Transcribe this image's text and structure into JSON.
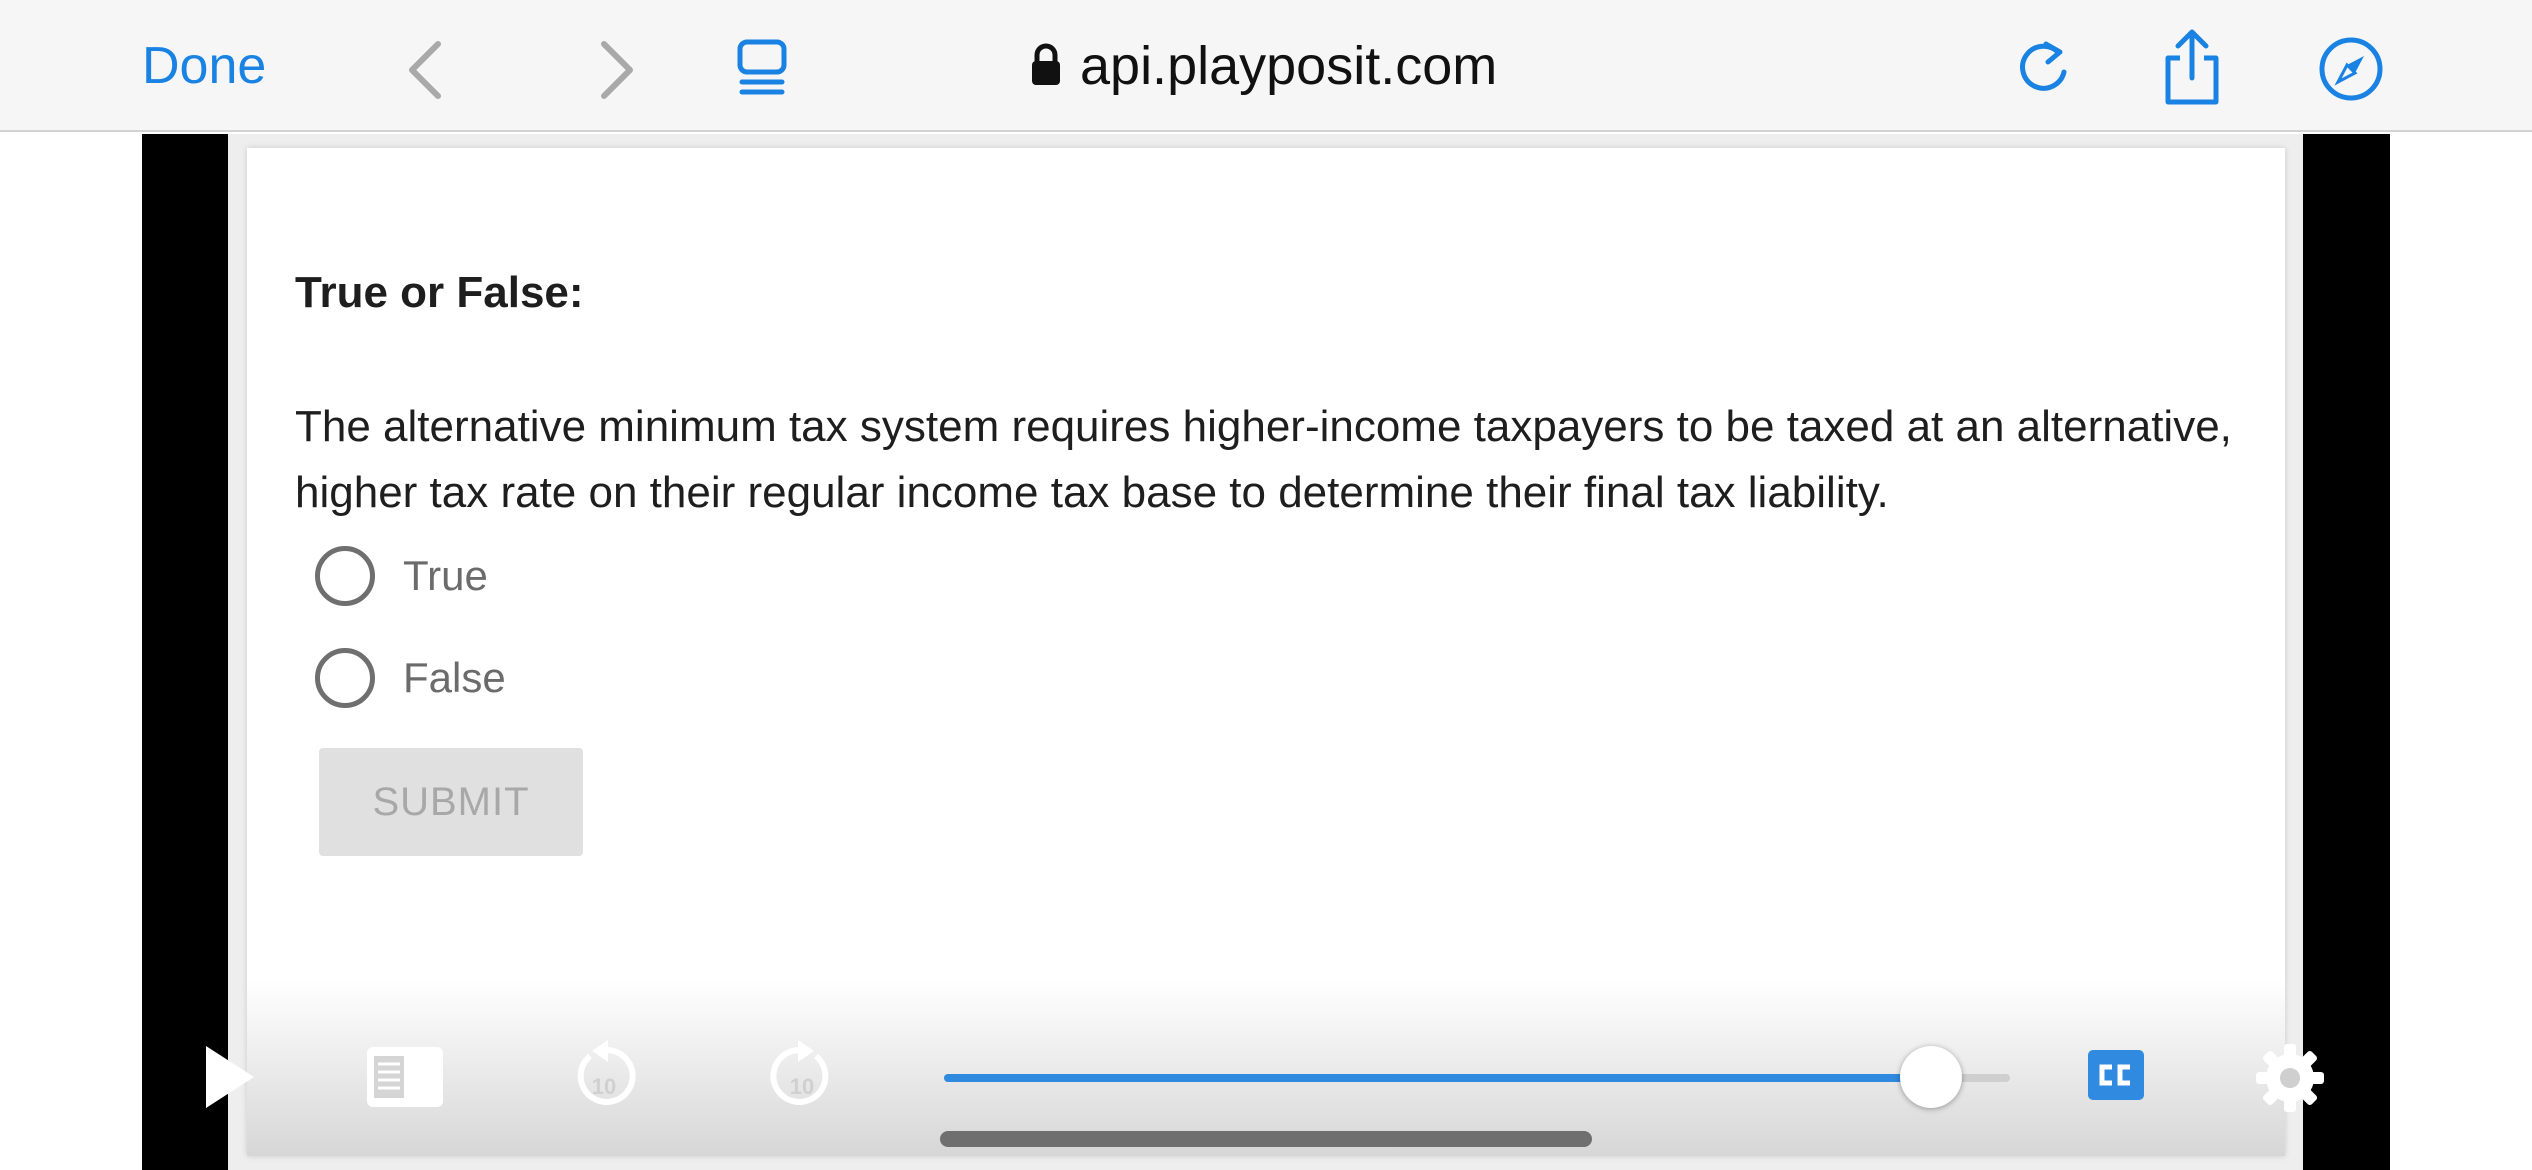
{
  "browser": {
    "done_label": "Done",
    "url": "api.playposit.com",
    "icons": {
      "back": "chevron-left-icon",
      "forward": "chevron-right-icon",
      "tabs": "tab-overview-icon",
      "lock": "lock-icon",
      "reload": "reload-icon",
      "share": "share-icon",
      "safari": "compass-icon"
    },
    "accent_color": "#1a82e2"
  },
  "question": {
    "title": "True or False:",
    "body": "The alternative minimum tax system requires higher-income taxpayers to be taxed at an alternative, higher tax rate on their regular income tax base to determine their final tax liability.",
    "options": [
      {
        "label": "True",
        "selected": false
      },
      {
        "label": "False",
        "selected": false
      }
    ],
    "submit_label": "SUBMIT"
  },
  "player": {
    "progress": 0.926,
    "progress_color": "#2f8ae0",
    "captions_color": "#2f8ae0",
    "icons": [
      "play-icon",
      "transcript-icon",
      "rewind-10-icon",
      "forward-10-icon",
      "captions-icon",
      "settings-gear-icon"
    ],
    "skip_seconds": "10"
  }
}
